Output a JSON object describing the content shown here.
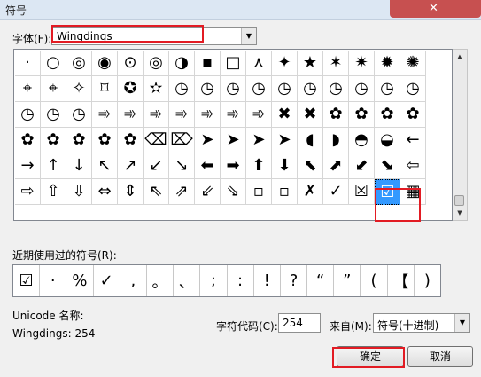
{
  "window": {
    "title": "符号"
  },
  "font": {
    "label": "字体(F):",
    "value": "Wingdings"
  },
  "symbols": [
    "·",
    "○",
    "◎",
    "◉",
    "⊙",
    "◎",
    "◑",
    "▪",
    "□",
    "⋏",
    "✦",
    "★",
    "✶",
    "✷",
    "✹",
    "✺",
    "⌖",
    "⌖",
    "✧",
    "⌑",
    "✪",
    "✫",
    "◷",
    "◷",
    "◷",
    "◷",
    "◷",
    "◷",
    "◷",
    "◷",
    "◷",
    "◷",
    "◷",
    "◷",
    "◷",
    "➾",
    "➾",
    "➾",
    "➾",
    "➾",
    "➾",
    "➾",
    "✖",
    "✖",
    "✿",
    "✿",
    "✿",
    "✿",
    "✿",
    "✿",
    "✿",
    "✿",
    "✿",
    "⌫",
    "⌦",
    "➤",
    "➤",
    "➤",
    "➤",
    "◖",
    "◗",
    "◓",
    "◒",
    "←",
    "→",
    "↑",
    "↓",
    "↖",
    "↗",
    "↙",
    "↘",
    "⬅",
    "➡",
    "⬆",
    "⬇",
    "⬉",
    "⬈",
    "⬋",
    "⬊",
    "⇦",
    "⇨",
    "⇧",
    "⇩",
    "⇔",
    "⇕",
    "⇖",
    "⇗",
    "⇙",
    "⇘",
    "▫",
    "▫",
    "✗",
    "✓",
    "☒",
    "☑",
    "▦"
  ],
  "recent": {
    "label": "近期使用过的符号(R):",
    "items": [
      "☑",
      "·",
      "%",
      "✓",
      ",",
      "。",
      "、",
      ";",
      ":",
      "!",
      "?",
      "“",
      "”",
      "(",
      "【",
      ")"
    ]
  },
  "unicode": {
    "label": "Unicode 名称:",
    "value": "Wingdings: 254"
  },
  "code": {
    "label": "字符代码(C):",
    "value": "254"
  },
  "from": {
    "label": "来自(M):",
    "value": "符号(十进制)"
  },
  "buttons": {
    "ok": "确定",
    "cancel": "取消"
  },
  "colors": {
    "highlight": "#e21b23",
    "selection": "#3399ff"
  }
}
